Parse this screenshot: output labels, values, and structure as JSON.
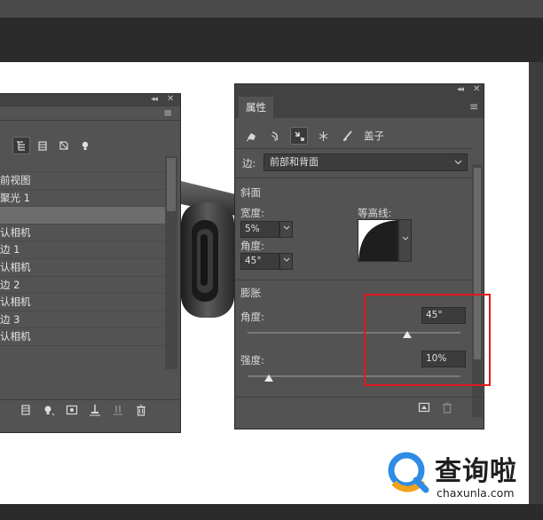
{
  "layers_panel": {
    "collapse": "◂◂",
    "close": "✕",
    "menu": "≡",
    "layers": [
      {
        "label": "前视图",
        "selected": false
      },
      {
        "label": "聚光 1",
        "selected": false
      },
      {
        "label": "",
        "selected": true
      },
      {
        "label": "认相机",
        "selected": false
      },
      {
        "label": "边 1",
        "selected": false
      },
      {
        "label": "认相机",
        "selected": false
      },
      {
        "label": "边 2",
        "selected": false
      },
      {
        "label": "认相机",
        "selected": false
      },
      {
        "label": "边 3",
        "selected": false
      },
      {
        "label": "认相机",
        "selected": false
      }
    ]
  },
  "properties_panel": {
    "collapse": "◂◂",
    "close": "✕",
    "menu": "≡",
    "tab_label": "属性",
    "cap_label": "盖子",
    "edge": {
      "label": "边:",
      "value": "前部和背面"
    },
    "bevel": {
      "section_label": "斜面",
      "width_label": "宽度:",
      "width_value": "5%",
      "angle_label": "角度:",
      "angle_value": "45°",
      "contour_label": "等高线:"
    },
    "inflate": {
      "section_label": "膨胀",
      "angle_label": "角度:",
      "angle_value": "45°",
      "angle_slider": 0.75,
      "strength_label": "强度:",
      "strength_value": "10%",
      "strength_slider": 0.1
    }
  },
  "watermark": {
    "brand": "查询啦",
    "url": "chaxunla.com"
  },
  "colors": {
    "panel_bg": "#535353",
    "highlight": "#e0191e"
  }
}
